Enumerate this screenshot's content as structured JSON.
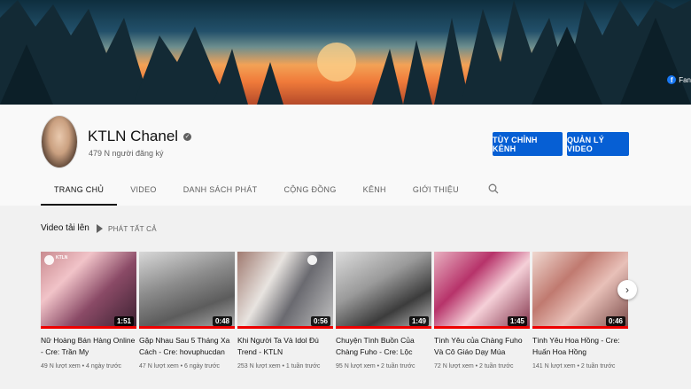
{
  "banner": {
    "social_link": "Fan"
  },
  "channel": {
    "name": "KTLN Chanel",
    "subscribers": "479 N người đăng ký",
    "customize_button": "TÙY CHỈNH KÊNH",
    "manage_button": "QUẢN LÝ VIDEO"
  },
  "tabs": [
    "TRANG CHỦ",
    "VIDEO",
    "DANH SÁCH PHÁT",
    "CỘNG ĐỒNG",
    "KÊNH",
    "GIỚI THIỆU"
  ],
  "section": {
    "title": "Video tải lên",
    "play_all": "PHÁT TẤT CẢ"
  },
  "thumbnail_badge": "KTLN",
  "videos": [
    {
      "title": "Nữ Hoàng Bán Hàng Online - Cre: Trần My",
      "meta": "49 N lượt xem • 4 ngày trước",
      "duration": "1:51",
      "watched": 1.0
    },
    {
      "title": "Gặp Nhau Sau 5 Tháng Xa Cách - Cre: hovuphucdan",
      "meta": "47 N lượt xem • 6 ngày trước",
      "duration": "0:48",
      "watched": 1.0
    },
    {
      "title": "Khi Người Ta Và Idol Đú Trend - KTLN",
      "meta": "253 N lượt xem • 1 tuần trước",
      "duration": "0:56",
      "watched": 1.0
    },
    {
      "title": "Chuyện Tình Buồn Của Chàng Fuho - Cre: Lộc Fuho",
      "meta": "95 N lượt xem • 2 tuần trước",
      "duration": "1:49",
      "watched": 1.0
    },
    {
      "title": "Tình Yêu của Chàng Fuho Và Cô Giáo Dạy Múa",
      "meta": "72 N lượt xem • 2 tuần trước",
      "duration": "1:45",
      "watched": 1.0
    },
    {
      "title": "Tình Yêu Hoa Hồng - Cre: Huấn Hoa Hồng",
      "meta": "141 N lượt xem • 2 tuần trước",
      "duration": "0:46",
      "watched": 1.0
    }
  ]
}
